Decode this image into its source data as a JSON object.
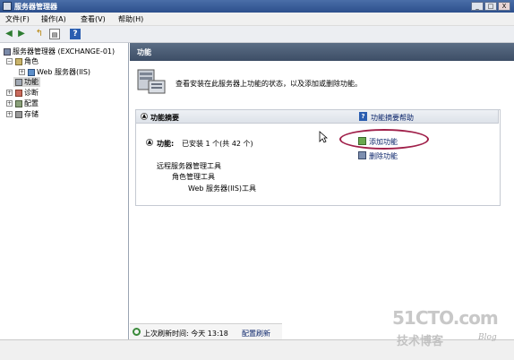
{
  "window": {
    "title": "服务器管理器",
    "controls": [
      "_",
      "□",
      "X"
    ]
  },
  "menubar": {
    "items": [
      "文件(F)",
      "操作(A)",
      "查看(V)",
      "帮助(H)"
    ]
  },
  "toolbar": {
    "icons": [
      "back-icon",
      "forward-icon",
      "up-icon",
      "show-hide-tree-icon",
      "help-icon"
    ]
  },
  "tree": {
    "root": "服务器管理器 (EXCHANGE-01)",
    "roles": "角色",
    "web_role": "Web 服务器(IIS)",
    "features": "功能",
    "diagnostics": "诊断",
    "configuration": "配置",
    "storage": "存储"
  },
  "panel": {
    "header": "功能",
    "description": "查看安装在此服务器上功能的状态，以及添加或删除功能。",
    "summary": {
      "title": "功能摘要",
      "help_link": "功能摘要帮助",
      "installed_label": "功能:",
      "installed_text": "已安装 1 个(共 42 个)",
      "tree_level1": "远程服务器管理工具",
      "tree_level2": "角色管理工具",
      "tree_level3": "Web 服务器(IIS)工具",
      "add_features": "添加功能",
      "remove_features": "删除功能"
    },
    "status": {
      "label": "上次刷新时间: 今天 13:18",
      "refresh": "配置刷新"
    }
  },
  "watermark": {
    "brand": "51CTO.com",
    "sub": "技术博客",
    "tag": "Blog"
  },
  "colors": {
    "title_bar": "#2c4f8c",
    "panel_header": "#3d4e66",
    "link": "#0a246a",
    "highlight_oval": "#a0204a"
  }
}
